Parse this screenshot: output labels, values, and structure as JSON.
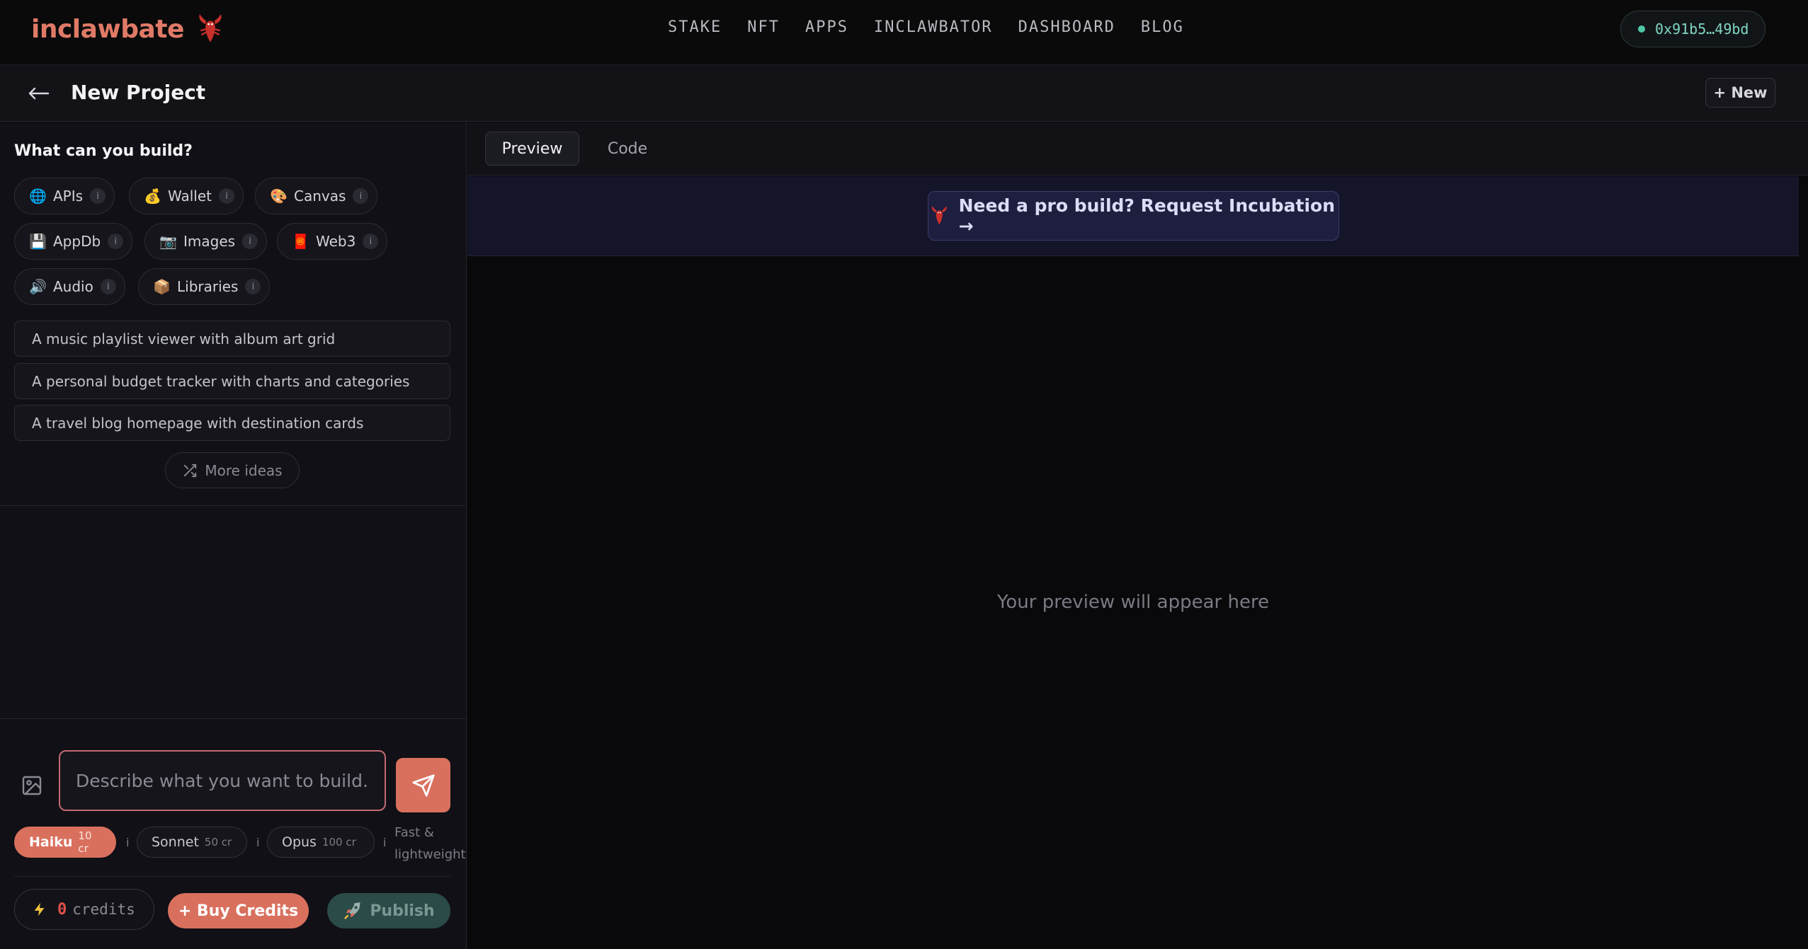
{
  "brand": {
    "name": "inclawbate",
    "icon": "lobster-icon"
  },
  "nav": {
    "items": [
      "STAKE",
      "NFT",
      "APPS",
      "INCLAWBATOR",
      "DASHBOARD",
      "BLOG"
    ]
  },
  "wallet": {
    "address": "0x91b5…49bd",
    "status_color": "#4fc7a5"
  },
  "project": {
    "back_icon": "arrow-left-icon",
    "title": "New Project",
    "new_label": "+ New"
  },
  "capabilities": {
    "heading": "What can you build?",
    "info_glyph": "i",
    "chips": [
      {
        "emoji": "🌐",
        "label": "APIs"
      },
      {
        "emoji": "💰",
        "label": "Wallet"
      },
      {
        "emoji": "🎨",
        "label": "Canvas"
      },
      {
        "emoji": "💾",
        "label": "AppDb"
      },
      {
        "emoji": "📷",
        "label": "Images"
      },
      {
        "emoji": "🧧",
        "label": "Web3"
      },
      {
        "emoji": "🔊",
        "label": "Audio"
      },
      {
        "emoji": "📦",
        "label": "Libraries"
      }
    ]
  },
  "ideas": [
    "A music playlist viewer with album art grid",
    "A personal budget tracker with charts and categories",
    "A travel blog homepage with destination cards"
  ],
  "more_ideas": {
    "label": "More ideas",
    "icon": "shuffle-icon"
  },
  "composer": {
    "placeholder": "Describe what you want to build...",
    "image_icon": "image-icon",
    "send_icon": "send-icon"
  },
  "models": {
    "items": [
      {
        "name": "Haiku",
        "cost": "10 cr",
        "active": true
      },
      {
        "name": "Sonnet",
        "cost": "50 cr",
        "active": false
      },
      {
        "name": "Opus",
        "cost": "100 cr",
        "active": false
      }
    ],
    "info_glyph": "i",
    "description": "Fast & lightweight"
  },
  "credits": {
    "icon": "lightning-icon",
    "value": "0",
    "label": "credits"
  },
  "actions": {
    "buy_label": "+ Buy Credits",
    "publish_label": "Publish",
    "publish_icon": "rocket-icon"
  },
  "tabs": {
    "preview": "Preview",
    "code": "Code"
  },
  "promo": {
    "icon": "lobster-icon",
    "label": "Need a pro build? Request Incubation →"
  },
  "preview": {
    "empty_text": "Your preview will appear here"
  },
  "colors": {
    "accent": "#d9705e",
    "brand": "#e07a67",
    "publish_bg": "#2b4b48",
    "promo_bg": "#1e1e3f"
  }
}
